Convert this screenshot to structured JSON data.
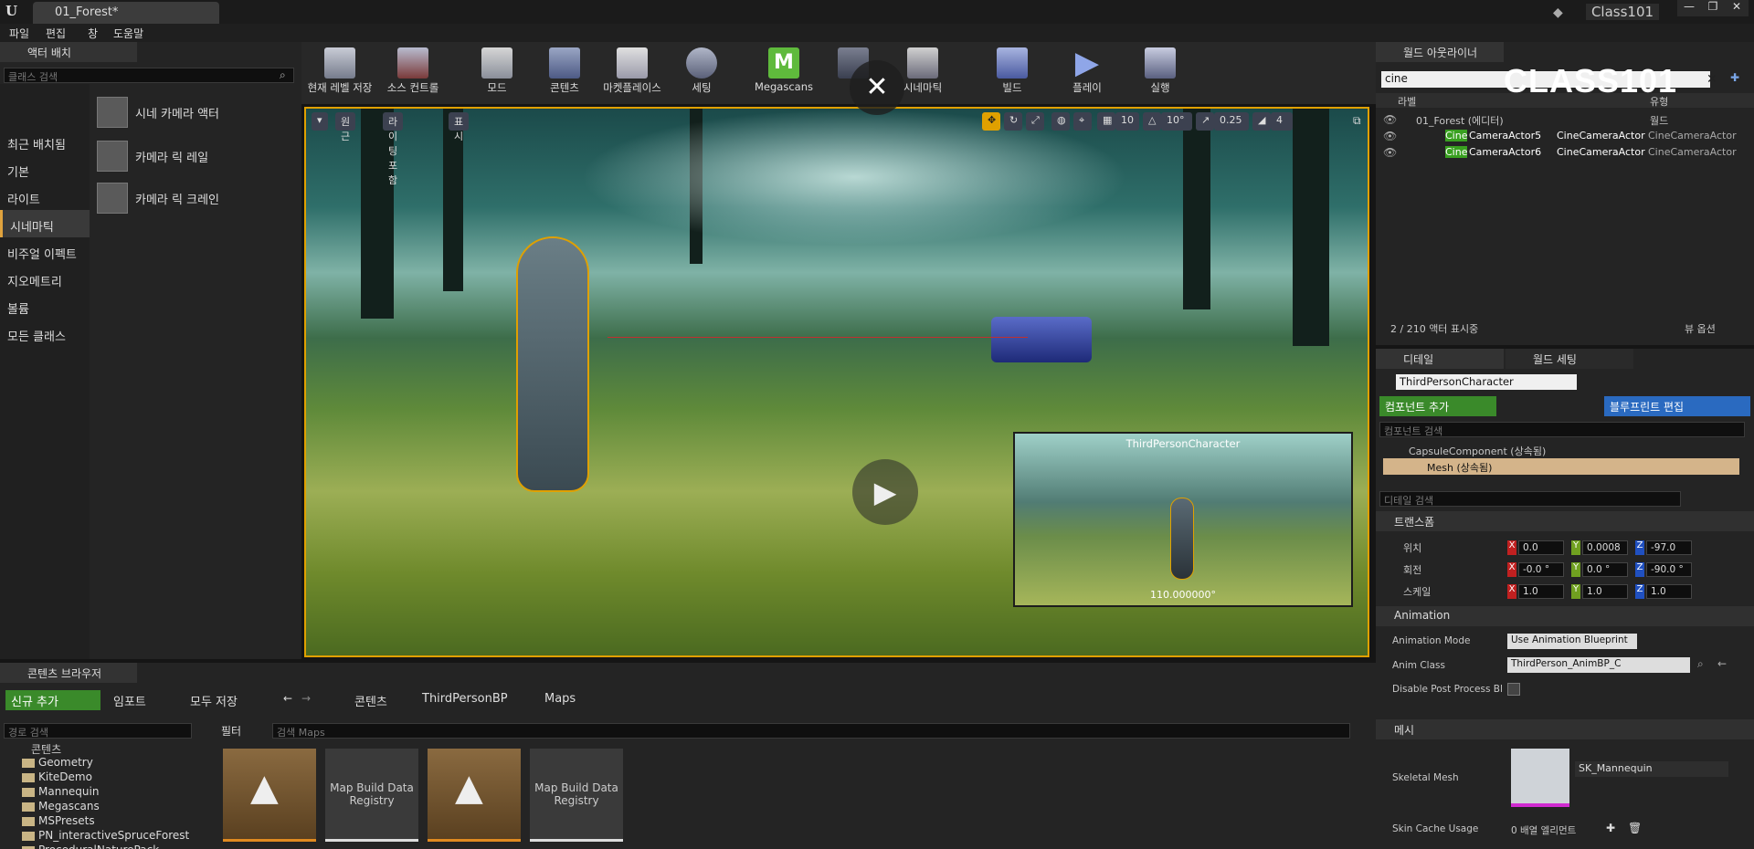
{
  "app": {
    "logo": "U",
    "tab_title": "01_Forest*",
    "project": "Class101",
    "brand_watermark": "CLASS101"
  },
  "menu": [
    "파일",
    "편집",
    "창",
    "도움말"
  ],
  "place_actors": {
    "tab": "액터 배치",
    "search_placeholder": "클래스 검색",
    "categories": [
      "최근 배치됨",
      "기본",
      "라이트",
      "시네마틱",
      "비주얼 이펙트",
      "지오메트리",
      "볼륨",
      "모든 클래스"
    ],
    "selected_category": "시네마틱",
    "items": [
      "시네 카메라 액터",
      "카메라 릭 레일",
      "카메라 릭 크레인"
    ]
  },
  "toolbar": {
    "buttons": [
      "현재 레벨 저장",
      "소스 컨트롤",
      "모드",
      "콘텐츠",
      "마켓플레이스",
      "세팅",
      "Megascans",
      "",
      "시네마틱",
      "빌드",
      "플레이",
      "실행"
    ]
  },
  "viewport": {
    "perspective": "원근",
    "lit": "라이팅포함",
    "show": "표시",
    "grid_snap": "10",
    "rot_snap": "10°",
    "scale_snap": "0.25",
    "cam_speed": "4",
    "preview_title": "ThirdPersonCharacter",
    "preview_value": "110.000000°"
  },
  "outliner": {
    "tab": "월드 아웃라이너",
    "search_value": "cine",
    "col_label": "라벨",
    "col_type": "유형",
    "rows": [
      {
        "label": "01_Forest (에디터)",
        "type": "월드"
      },
      {
        "label_hl": "Cine",
        "label_rest": "CameraActor5",
        "type_a": "CineCameraActor",
        "type_b": "CineCameraActor"
      },
      {
        "label_hl": "Cine",
        "label_rest": "CameraActor6",
        "type_a": "CineCameraActor",
        "type_b": "CineCameraActor"
      }
    ],
    "count": "2 / 210 액터 표시중",
    "view_options": "뷰 옵션"
  },
  "details": {
    "tab_details": "디테일",
    "tab_world": "월드 세팅",
    "actor_name": "ThirdPersonCharacter",
    "add_component": "컴포넌트 추가",
    "blueprint_edit": "블루프린트 편집",
    "comp_search": "컴포넌트 검색",
    "components": [
      "CapsuleComponent (상속됨)",
      "Mesh (상속됨)"
    ],
    "detail_search": "디테일 검색",
    "transform": "트랜스폼",
    "location_label": "위치",
    "rotation_label": "회전",
    "scale_label": "스케일",
    "location": [
      "0.0",
      "0.0008",
      "-97.0"
    ],
    "rotation": [
      "-0.0 °",
      "0.0 °",
      "-90.0 °"
    ],
    "scale": [
      "1.0",
      "1.0",
      "1.0"
    ],
    "animation": "Animation",
    "anim_mode_label": "Animation Mode",
    "anim_mode": "Use Animation Blueprint",
    "anim_class_label": "Anim Class",
    "anim_class": "ThirdPerson_AnimBP_C",
    "disable_pp_label": "Disable Post Process Bl",
    "mesh_section": "메시",
    "skeletal_mesh_label": "Skeletal Mesh",
    "skeletal_mesh": "SK_Mannequin",
    "skin_cache_label": "Skin Cache Usage",
    "skin_cache": "0 배열 엘리먼트"
  },
  "content_browser": {
    "tab": "콘텐츠 브라우저",
    "add_new": "신규 추가",
    "import": "임포트",
    "save_all": "모두 저장",
    "path": [
      "콘텐츠",
      "ThirdPersonBP",
      "Maps"
    ],
    "path_search": "경로 검색",
    "filter": "필터",
    "asset_search": "검색 Maps",
    "tree_root": "콘텐츠",
    "folders": [
      "Geometry",
      "KiteDemo",
      "Mannequin",
      "Megascans",
      "MSPresets",
      "PN_interactiveSpruceForest",
      "ProceduralNaturePack"
    ],
    "assets": [
      "",
      "Map Build Data Registry",
      "",
      "Map Build Data Registry"
    ]
  }
}
